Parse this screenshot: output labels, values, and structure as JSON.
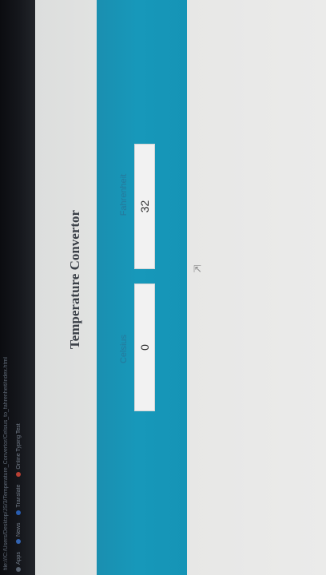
{
  "browser": {
    "address": "file:///C:/Users/Desktop/JS/3/Temperature_Convertor/Celsius_to_fahrenheit/index.html",
    "bookmarks": [
      {
        "label": "Apps",
        "icon": "apps-icon",
        "color": "#6a7686"
      },
      {
        "label": "News",
        "icon": "news-icon",
        "color": "#3b78d8"
      },
      {
        "label": "Translate",
        "icon": "translate-icon",
        "color": "#2f6fd6"
      },
      {
        "label": "Online Typing Test",
        "icon": "typing-test-icon",
        "color": "#e24b3b"
      }
    ]
  },
  "page": {
    "title": "Temperature Convertor"
  },
  "converter": {
    "celsius_label": "Celsius",
    "celsius_value": "0",
    "fahrenheit_label": "Fahrenheit",
    "fahrenheit_value": "32"
  },
  "colors": {
    "band": "#1798ba",
    "background": "#e6e6e5"
  }
}
